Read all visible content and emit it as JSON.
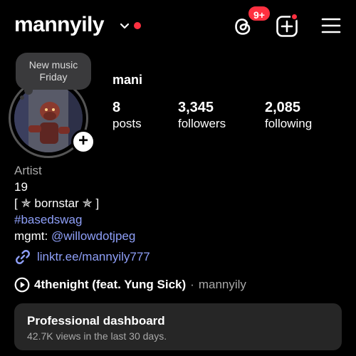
{
  "header": {
    "username": "mannyily",
    "threads_badge": "9+",
    "colors": {
      "badge": "#ff3040"
    },
    "icons": [
      "chevron-down-icon",
      "threads-icon",
      "add-post-icon",
      "menu-icon"
    ]
  },
  "note": {
    "text_line1": "New music",
    "text_line2": "Friday"
  },
  "profile": {
    "display_name": "mani",
    "stats": [
      {
        "value": "8",
        "label": "posts"
      },
      {
        "value": "3,345",
        "label": "followers"
      },
      {
        "value": "2,085",
        "label": "following"
      }
    ]
  },
  "bio": {
    "category": "Artist",
    "line1": "19",
    "line2": "[ ✯ bornstar ✯ ]",
    "hashtag": "#basedswag",
    "mgmt_label": "mgmt: ",
    "mgmt_handle": "@willowdotjpeg",
    "link": "linktr.ee/mannyily777"
  },
  "music": {
    "song": "4thenight (feat. Yung Sick)",
    "separator": "·",
    "artist": "mannyily"
  },
  "dashboard": {
    "title": "Professional dashboard",
    "subtitle": "42.7K views in the last 30 days."
  },
  "colors": {
    "link": "#8e9ff8",
    "card": "#262626",
    "note": "#3a3a3c"
  }
}
